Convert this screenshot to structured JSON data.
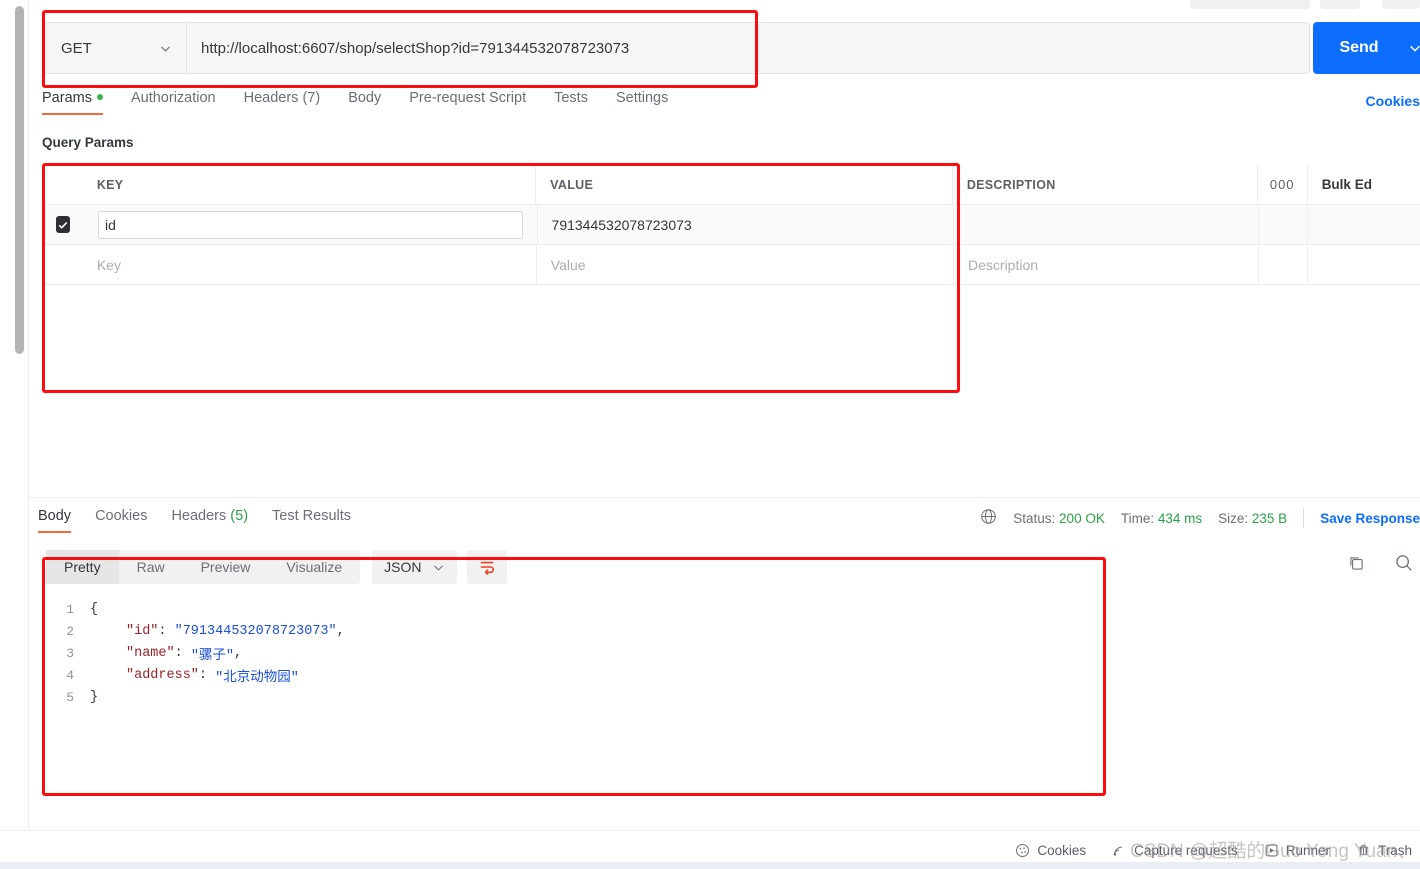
{
  "request": {
    "method": "GET",
    "url": "http://localhost:6607/shop/selectShop?id=791344532078723073",
    "send_label": "Send",
    "tabs": [
      {
        "label": "Params",
        "badge": "dot",
        "active": true
      },
      {
        "label": "Authorization",
        "badge": "",
        "active": false
      },
      {
        "label": "Headers",
        "badge": "(7)",
        "active": false
      },
      {
        "label": "Body",
        "badge": "",
        "active": false
      },
      {
        "label": "Pre-request Script",
        "badge": "",
        "active": false
      },
      {
        "label": "Tests",
        "badge": "",
        "active": false
      },
      {
        "label": "Settings",
        "badge": "",
        "active": false
      }
    ],
    "cookies_link": "Cookies"
  },
  "params": {
    "section_title": "Query Params",
    "columns": {
      "key": "KEY",
      "value": "VALUE",
      "description": "DESCRIPTION",
      "more": "000",
      "bulk_edit": "Bulk Ed"
    },
    "rows": [
      {
        "checked": true,
        "key": "id",
        "value": "791344532078723073",
        "description": ""
      }
    ],
    "placeholders": {
      "key": "Key",
      "value": "Value",
      "description": "Description"
    }
  },
  "response": {
    "tabs": [
      {
        "label": "Body",
        "badge": "",
        "active": true
      },
      {
        "label": "Cookies",
        "badge": "",
        "active": false
      },
      {
        "label": "Headers",
        "badge": "(5)",
        "active": false
      },
      {
        "label": "Test Results",
        "badge": "",
        "active": false
      }
    ],
    "meta": {
      "status_label": "Status:",
      "status_value": "200 OK",
      "time_label": "Time:",
      "time_value": "434 ms",
      "size_label": "Size:",
      "size_value": "235 B",
      "save_response": "Save Response"
    },
    "viewer": {
      "modes": [
        {
          "label": "Pretty",
          "active": true
        },
        {
          "label": "Raw",
          "active": false
        },
        {
          "label": "Preview",
          "active": false
        },
        {
          "label": "Visualize",
          "active": false
        }
      ],
      "format": "JSON"
    },
    "body_lines": [
      {
        "num": "1",
        "fold": "{",
        "indent": false,
        "key": "",
        "colon": "",
        "value": "",
        "comma": "",
        "raw": ""
      },
      {
        "num": "2",
        "fold": "",
        "indent": true,
        "key": "\"id\"",
        "colon": ": ",
        "value": "\"791344532078723073\"",
        "comma": ",",
        "raw": ""
      },
      {
        "num": "3",
        "fold": "",
        "indent": true,
        "key": "\"name\"",
        "colon": ": ",
        "value": "\"骡子\"",
        "comma": ",",
        "raw": ""
      },
      {
        "num": "4",
        "fold": "",
        "indent": true,
        "key": "\"address\"",
        "colon": ": ",
        "value": "\"北京动物园\"",
        "comma": "",
        "raw": ""
      },
      {
        "num": "5",
        "fold": "}",
        "indent": false,
        "key": "",
        "colon": "",
        "value": "",
        "comma": "",
        "raw": ""
      }
    ]
  },
  "status_bar": {
    "cookies": "Cookies",
    "capture_requests": "Capture requests",
    "runner": "Runner",
    "trash": "Trash"
  },
  "watermark": "CSDN @超酷的Guo Yong Yuan、",
  "colors": {
    "accent_blue": "#0d6efd",
    "tab_underline": "#f26b3a",
    "status_green": "#2aa148",
    "annotation_red": "#fb0d0d",
    "json_key": "#9b2226",
    "json_string": "#1a4fd6"
  }
}
